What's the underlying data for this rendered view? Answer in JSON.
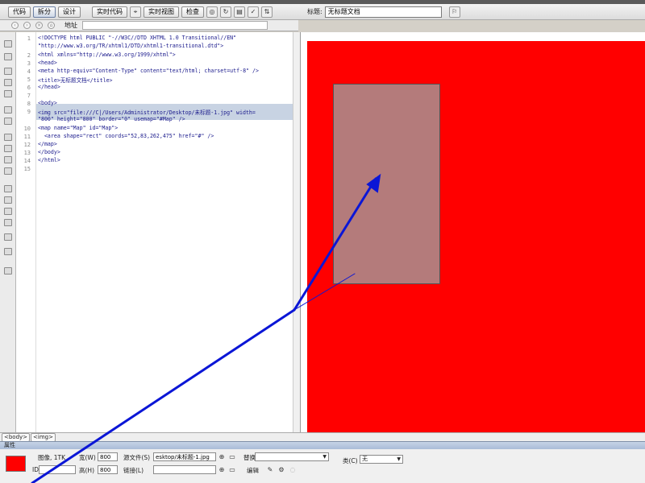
{
  "toolbar": {
    "code_label": "代码",
    "split_label": "拆分",
    "design_label": "设计",
    "live_code_label": "实时代码",
    "live_view_label": "实时视图",
    "inspect_label": "检查",
    "title_label": "标题:",
    "title_value": "无标题文档"
  },
  "address": {
    "label": "地址"
  },
  "code": {
    "line_numbers": [
      "1",
      "2",
      "3",
      "4",
      "5",
      "6",
      "7",
      "8",
      "9",
      "10",
      "11",
      "12",
      "13",
      "14",
      "15"
    ],
    "lines": [
      "<!DOCTYPE html PUBLIC \"-//W3C//DTD XHTML 1.0 Transitional//EN\"",
      "\"http://www.w3.org/TR/xhtml1/DTD/xhtml1-transitional.dtd\">",
      "<html xmlns=\"http://www.w3.org/1999/xhtml\">",
      "<head>",
      "<meta http-equiv=\"Content-Type\" content=\"text/html; charset=utf-8\" />",
      "<title>无标题文档</title>",
      "</head>",
      "",
      "<body>",
      "<img src=\"file:///C|/Users/Administrator/Desktop/未标题-1.jpg\" width=",
      "\"800\" height=\"800\" border=\"0\" usemap=\"#Map\" />",
      "<map name=\"Map\" id=\"Map\">",
      "  <area shape=\"rect\" coords=\"52,83,262,475\" href=\"#\" />",
      "</map>",
      "</body>",
      "</html>"
    ]
  },
  "tag_selector": {
    "items": [
      "<body>",
      "<img>"
    ]
  },
  "properties": {
    "panel_title": "属性",
    "image_label": "图像, 1TK",
    "width_label": "宽(W)",
    "width_value": "800",
    "height_label": "高(H)",
    "height_value": "800",
    "src_label": "源文件(S)",
    "src_value": "esktop/未标题-1.jpg",
    "alt_label": "替换(T)",
    "alt_value": "",
    "class_label": "类(C)",
    "class_value": "无",
    "id_label": "ID",
    "link_label": "链接(L)",
    "edit_label": "编辑"
  },
  "colors": {
    "canvas": "#ff0000",
    "hotspot": "#b08282",
    "annotation_arrow": "#0b16d6"
  }
}
